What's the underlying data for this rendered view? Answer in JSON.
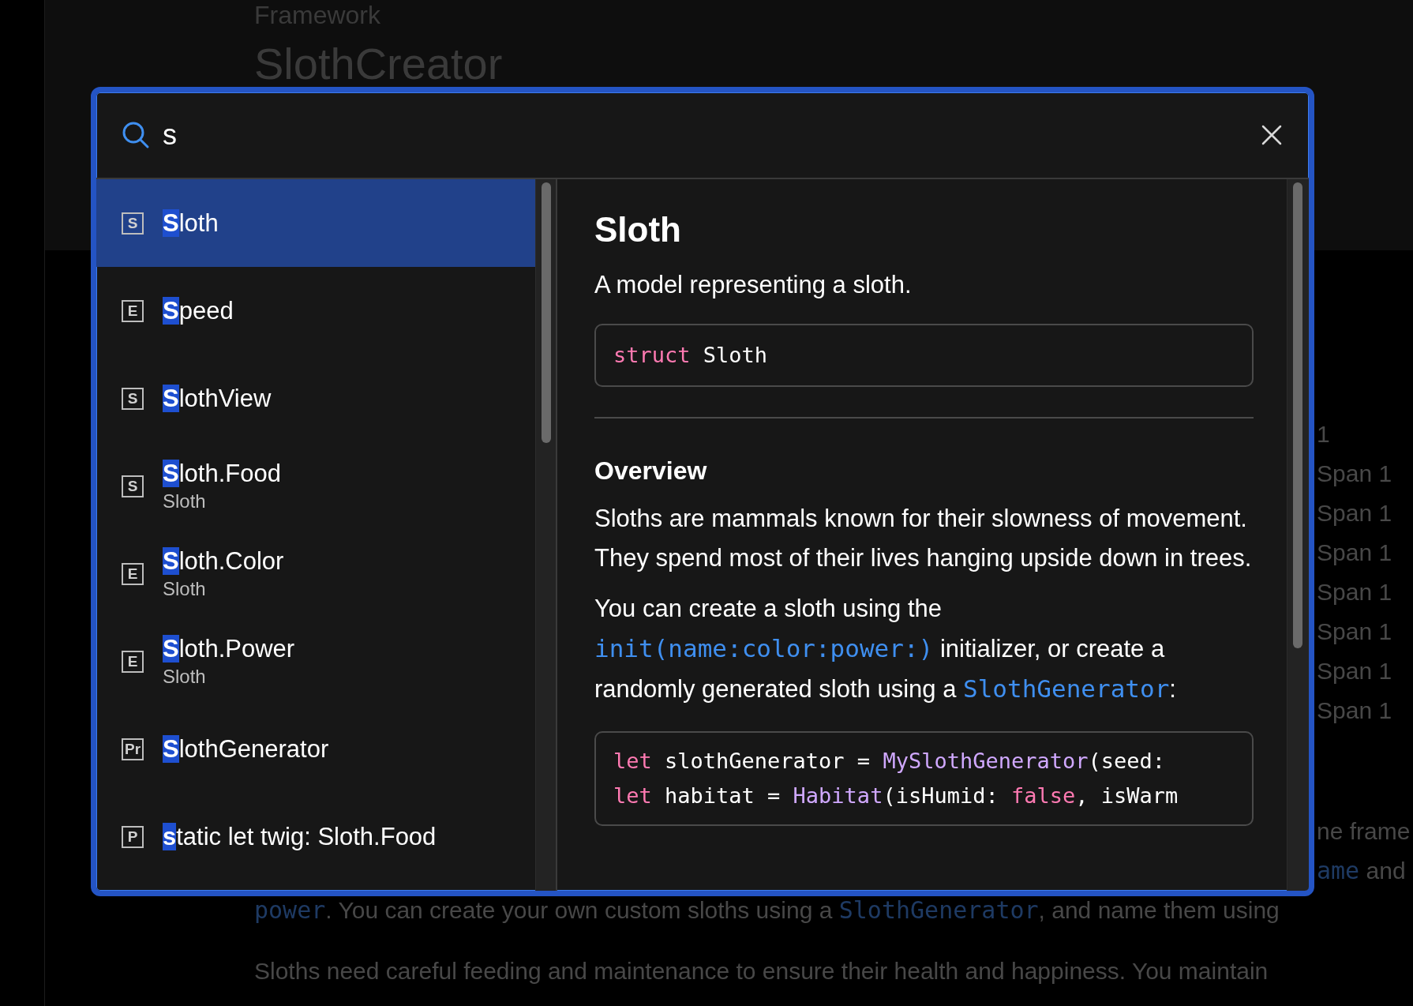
{
  "background": {
    "eyebrow": "Framework",
    "title": "SlothCreator",
    "side_fragments": [
      "1",
      "Span 1",
      "Span 1",
      "Span 1",
      "Span 1",
      "Span 1",
      "Span 1",
      "Span 1"
    ],
    "paragraph_fragments": [
      [
        {
          "kind": "text",
          "text": "ne frame"
        }
      ],
      [
        {
          "kind": "code",
          "text": "ame"
        },
        {
          "kind": "text",
          "text": " and"
        }
      ]
    ],
    "paragraphs": [
      [
        {
          "kind": "code",
          "text": "power"
        },
        {
          "kind": "text",
          "text": ". You can create your own custom sloths using a "
        },
        {
          "kind": "code",
          "text": "SlothGenerator"
        },
        {
          "kind": "text",
          "text": ", and name them using"
        }
      ],
      [
        {
          "kind": "text",
          "text": "Sloths need careful feeding and maintenance to ensure their health and happiness. You maintain"
        }
      ]
    ]
  },
  "search": {
    "query": "s"
  },
  "results": [
    {
      "badge": "S",
      "title": "Sloth",
      "selected": true
    },
    {
      "badge": "E",
      "title": "Speed",
      "selected": false
    },
    {
      "badge": "S",
      "title": "SlothView",
      "selected": false
    },
    {
      "badge": "S",
      "title": "Sloth.Food",
      "subtitle": "Sloth",
      "selected": false
    },
    {
      "badge": "E",
      "title": "Sloth.Color",
      "subtitle": "Sloth",
      "selected": false
    },
    {
      "badge": "E",
      "title": "Sloth.Power",
      "subtitle": "Sloth",
      "selected": false
    },
    {
      "badge": "Pr",
      "title": "SlothGenerator",
      "selected": false
    },
    {
      "badge": "P",
      "title": "static let twig: Sloth.Food",
      "selected": false
    }
  ],
  "preview": {
    "title": "Sloth",
    "summary": "A model representing a sloth.",
    "declaration": [
      {
        "kind": "keyword",
        "text": "struct"
      },
      {
        "kind": "plain",
        "text": " Sloth"
      }
    ],
    "section_heading": "Overview",
    "paragraphs": [
      [
        {
          "kind": "text",
          "text": "Sloths are mammals known for their slowness of movement. They spend most of their lives hanging upside down in trees."
        }
      ],
      [
        {
          "kind": "text",
          "text": "You can create a sloth using the "
        },
        {
          "kind": "code_link",
          "text": "init(name:color:power:)"
        },
        {
          "kind": "text",
          "text": " initializer, or create a randomly generated sloth using a "
        },
        {
          "kind": "code_link",
          "text": "SlothGenerator"
        },
        {
          "kind": "text",
          "text": ":"
        }
      ]
    ],
    "code_lines": [
      [
        {
          "kind": "keyword",
          "text": "let"
        },
        {
          "kind": "plain",
          "text": " slothGenerator = "
        },
        {
          "kind": "type",
          "text": "MySlothGenerator"
        },
        {
          "kind": "plain",
          "text": "(seed:"
        }
      ],
      [
        {
          "kind": "keyword",
          "text": "let"
        },
        {
          "kind": "plain",
          "text": " habitat = "
        },
        {
          "kind": "type",
          "text": "Habitat"
        },
        {
          "kind": "plain",
          "text": "(isHumid: "
        },
        {
          "kind": "keyword",
          "text": "false"
        },
        {
          "kind": "plain",
          "text": ", isWarm"
        }
      ]
    ]
  }
}
